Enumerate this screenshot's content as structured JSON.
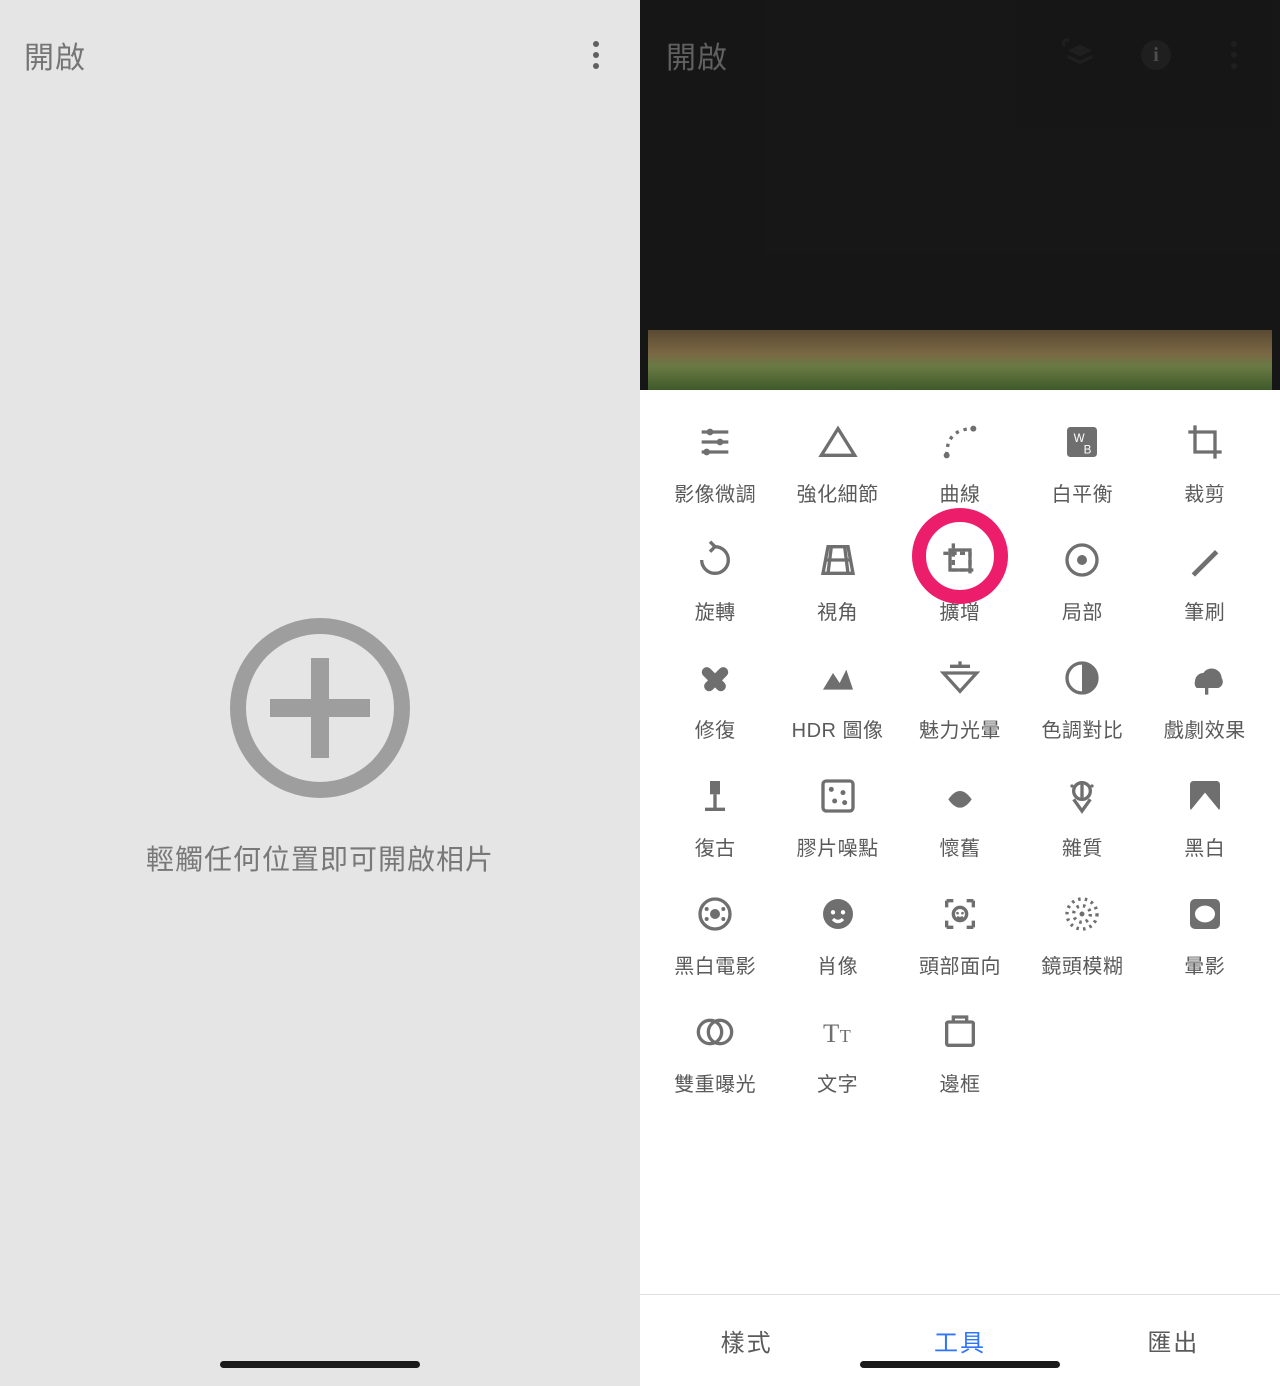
{
  "left": {
    "title": "開啟",
    "hint": "輕觸任何位置即可開啟相片"
  },
  "right": {
    "title": "開啟",
    "tools": [
      {
        "icon": "tune-icon",
        "label": "影像微調"
      },
      {
        "icon": "details-icon",
        "label": "強化細節"
      },
      {
        "icon": "curves-icon",
        "label": "曲線"
      },
      {
        "icon": "white-balance-icon",
        "label": "白平衡"
      },
      {
        "icon": "crop-icon",
        "label": "裁剪"
      },
      {
        "icon": "rotate-icon",
        "label": "旋轉"
      },
      {
        "icon": "perspective-icon",
        "label": "視角"
      },
      {
        "icon": "expand-icon",
        "label": "擴增",
        "highlight": true
      },
      {
        "icon": "selective-icon",
        "label": "局部"
      },
      {
        "icon": "brush-icon",
        "label": "筆刷"
      },
      {
        "icon": "healing-icon",
        "label": "修復"
      },
      {
        "icon": "hdr-icon",
        "label": "HDR 圖像"
      },
      {
        "icon": "glamour-icon",
        "label": "魅力光暈"
      },
      {
        "icon": "tonal-icon",
        "label": "色調對比"
      },
      {
        "icon": "drama-icon",
        "label": "戲劇效果"
      },
      {
        "icon": "vintage-icon",
        "label": "復古"
      },
      {
        "icon": "grainy-icon",
        "label": "膠片噪點"
      },
      {
        "icon": "retrolux-icon",
        "label": "懷舊"
      },
      {
        "icon": "grunge-icon",
        "label": "雜質"
      },
      {
        "icon": "bw-icon",
        "label": "黑白"
      },
      {
        "icon": "noir-icon",
        "label": "黑白電影"
      },
      {
        "icon": "portrait-icon",
        "label": "肖像"
      },
      {
        "icon": "headpose-icon",
        "label": "頭部面向"
      },
      {
        "icon": "lensblur-icon",
        "label": "鏡頭模糊"
      },
      {
        "icon": "vignette-icon",
        "label": "暈影"
      },
      {
        "icon": "double-exp-icon",
        "label": "雙重曝光"
      },
      {
        "icon": "text-icon",
        "label": "文字"
      },
      {
        "icon": "frame-icon",
        "label": "邊框"
      }
    ],
    "tabs": {
      "styles": "樣式",
      "tools": "工具",
      "export": "匯出",
      "active": "tools"
    }
  }
}
